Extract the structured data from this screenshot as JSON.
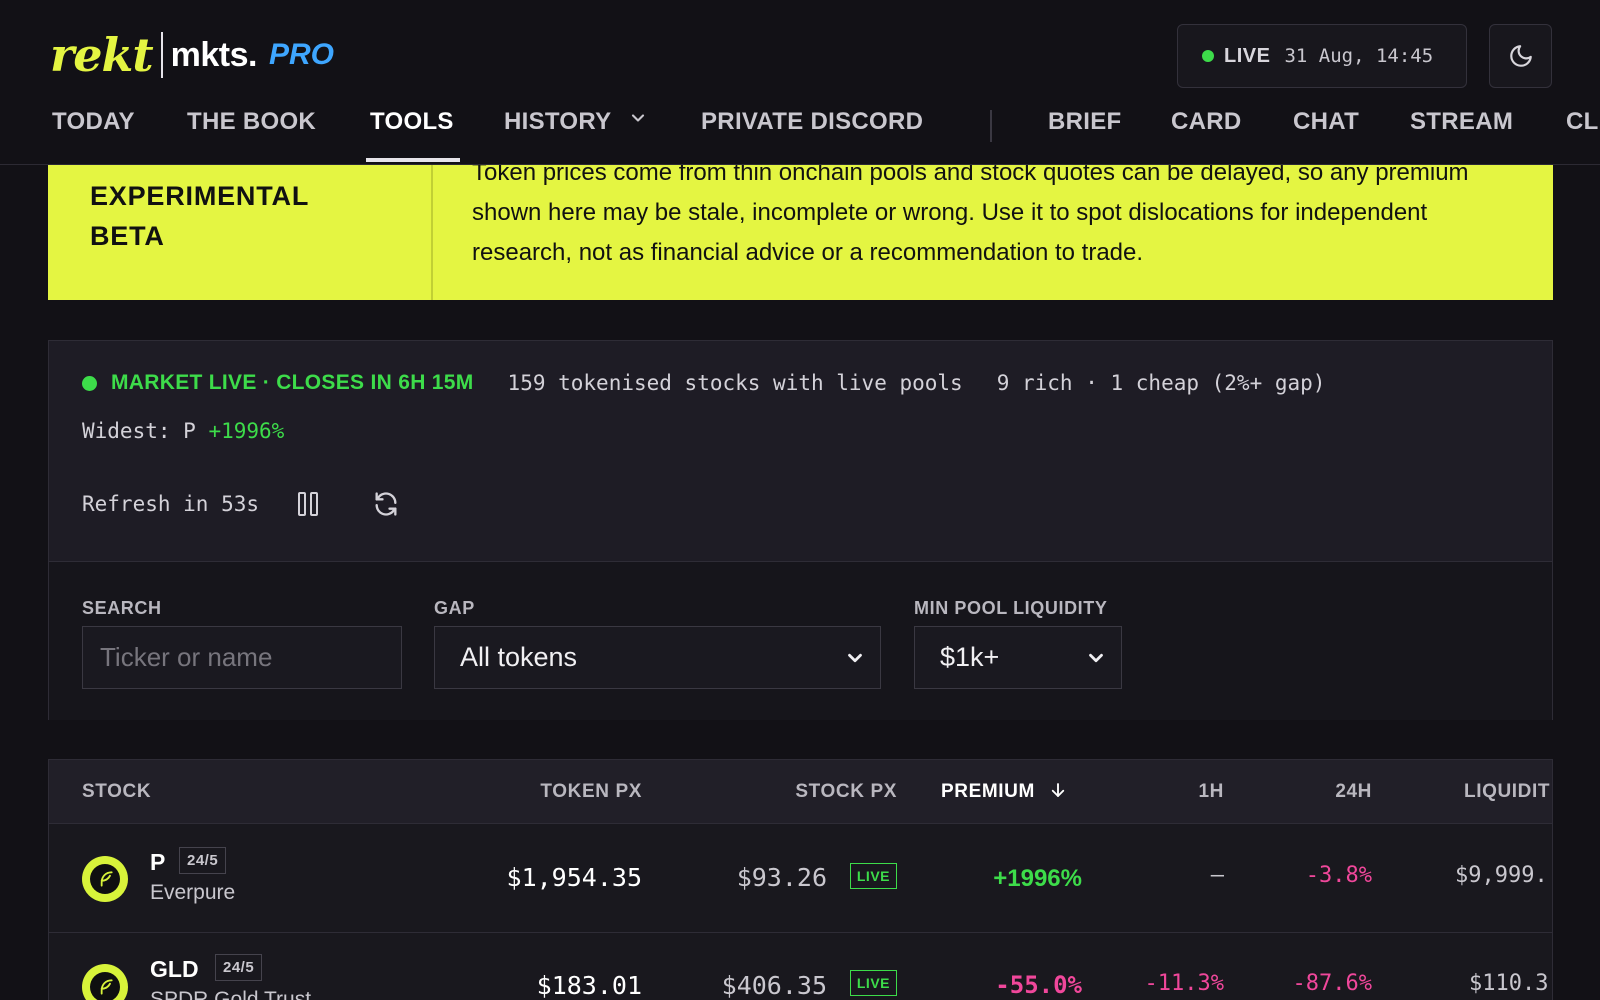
{
  "header": {
    "logo_script": "rekt",
    "logo_main": "mkts.",
    "logo_pro": "PRO",
    "live_label": "LIVE",
    "live_time": "31 Aug, 14:45",
    "theme_icon": "moon-icon"
  },
  "nav": {
    "items": [
      "TODAY",
      "THE BOOK",
      "TOOLS",
      "HISTORY",
      "PRIVATE DISCORD",
      "BRIEF",
      "CARD",
      "CHAT",
      "STREAM",
      "CL"
    ],
    "active": "TOOLS"
  },
  "beta": {
    "label": "EXPERIMENTAL BETA",
    "text": "Token prices come from thin onchain pools and stock quotes can be delayed, so any premium shown here may be stale, incomplete or wrong. Use it to spot dislocations for independent research, not as financial advice or a recommendation to trade."
  },
  "summary": {
    "market_status": "MARKET LIVE · CLOSES IN 6H 15M",
    "stocks_count": "159 tokenised stocks with live pools",
    "rich_cheap": "9 rich · 1 cheap (2%+ gap)",
    "widest_label": "Widest: P",
    "widest_value": "+1996%",
    "refresh_text": "Refresh in 53s"
  },
  "filters": {
    "search_label": "SEARCH",
    "search_placeholder": "Ticker or name",
    "gap_label": "GAP",
    "gap_value": "All tokens",
    "liquidity_label": "MIN POOL LIQUIDITY",
    "liquidity_value": "$1k+"
  },
  "table": {
    "headers": {
      "stock": "STOCK",
      "token_px": "TOKEN PX",
      "stock_px": "STOCK PX",
      "premium": "PREMIUM",
      "h1": "1H",
      "h24": "24H",
      "liquidity": "LIQUIDIT"
    },
    "rows": [
      {
        "ticker": "P",
        "hours": "24/5",
        "name": "Everpure",
        "token_px": "$1,954.35",
        "stock_px": "$93.26",
        "stock_badge": "LIVE",
        "premium": "+1996%",
        "h1": "–",
        "h24": "-3.8%",
        "liquidity": "$9,999."
      },
      {
        "ticker": "GLD",
        "hours": "24/5",
        "name": "SPDR Gold Trust",
        "token_px": "$183.01",
        "stock_px": "$406.35",
        "stock_badge": "LIVE",
        "premium": "-55.0%",
        "h1": "-11.3%",
        "h24": "-87.6%",
        "liquidity": "$110.3"
      }
    ]
  },
  "colors": {
    "accent_yellow": "#e4f542",
    "live_green": "#3ddc4a",
    "negative_pink": "#f0479b",
    "pro_blue": "#3ea6ff"
  }
}
